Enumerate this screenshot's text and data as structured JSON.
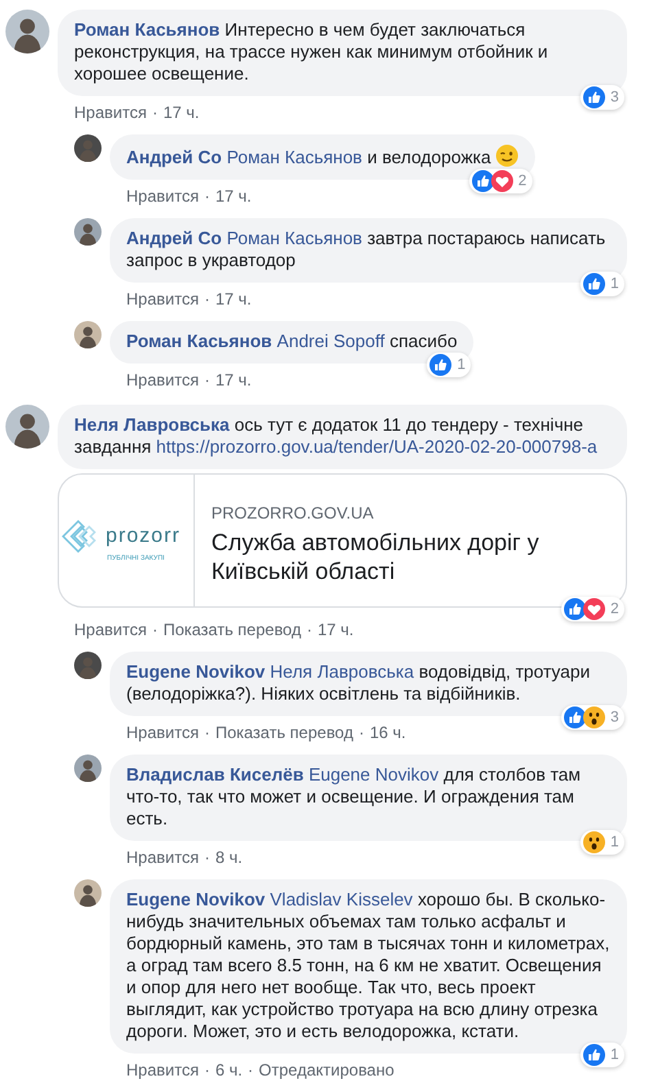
{
  "comments": [
    {
      "author": "Роман Касьянов",
      "text": "Интересно в чем будет заключаться реконструкция, на трассе нужен как минимум отбойник и хорошее освещение.",
      "reactions": {
        "icons": [
          {
            "kind": "like"
          }
        ],
        "count": "3"
      },
      "actions": [
        {
          "kind": "link",
          "text": "Нравится"
        },
        {
          "kind": "sep",
          "text": "·"
        },
        {
          "kind": "time",
          "text": "17 ч."
        }
      ],
      "replies": [
        {
          "author": "Андрей Со",
          "mention": "Роман Касьянов",
          "text": "и велодорожка",
          "emoji": true,
          "reactions": {
            "icons": [
              {
                "kind": "like"
              },
              {
                "kind": "love"
              }
            ],
            "count": "2"
          },
          "actions": [
            {
              "kind": "link",
              "text": "Нравится"
            },
            {
              "kind": "sep",
              "text": "·"
            },
            {
              "kind": "time",
              "text": "17 ч."
            }
          ]
        },
        {
          "author": "Андрей Со",
          "mention": "Роман Касьянов",
          "text": "завтра постараюсь написать запрос в укравтодор",
          "reactions": {
            "icons": [
              {
                "kind": "like"
              }
            ],
            "count": "1"
          },
          "actions": [
            {
              "kind": "link",
              "text": "Нравится"
            },
            {
              "kind": "sep",
              "text": "·"
            },
            {
              "kind": "time",
              "text": "17 ч."
            }
          ]
        },
        {
          "author": "Роман Касьянов",
          "mention": "Andrei Sopoff",
          "text": "спасибо",
          "reactions": {
            "icons": [
              {
                "kind": "like"
              }
            ],
            "count": "1"
          },
          "actions": [
            {
              "kind": "link",
              "text": "Нравится"
            },
            {
              "kind": "sep",
              "text": "·"
            },
            {
              "kind": "time",
              "text": "17 ч."
            }
          ]
        }
      ]
    },
    {
      "author": "Неля Лавровська",
      "text": "ось тут є додаток 11 до тендеру - технічне завдання",
      "link": "https://prozorro.gov.ua/tender/UA-2020-02-20-000798-a",
      "link_preview": {
        "logo_text": "prozorr",
        "logo_subtext": "ПУБЛІЧНІ ЗАКУПІ",
        "domain": "PROZORRO.GOV.UA",
        "title": "Служба автомобільних доріг у Київській області"
      },
      "reactions": {
        "icons": [
          {
            "kind": "like"
          },
          {
            "kind": "love"
          }
        ],
        "count": "2"
      },
      "actions": [
        {
          "kind": "link",
          "text": "Нравится"
        },
        {
          "kind": "sep",
          "text": "·"
        },
        {
          "kind": "link",
          "text": "Показать перевод"
        },
        {
          "kind": "sep",
          "text": "·"
        },
        {
          "kind": "time",
          "text": "17 ч."
        }
      ],
      "replies": [
        {
          "author": "Eugene Novikov",
          "mention": "Неля Лавровська",
          "text": "водовідвід, тротуари (велодоріжка?). Ніяких освітлень та відбійників.",
          "reactions": {
            "icons": [
              {
                "kind": "like"
              },
              {
                "kind": "wow"
              }
            ],
            "count": "3"
          },
          "actions": [
            {
              "kind": "link",
              "text": "Нравится"
            },
            {
              "kind": "sep",
              "text": "·"
            },
            {
              "kind": "link",
              "text": "Показать перевод"
            },
            {
              "kind": "sep",
              "text": "·"
            },
            {
              "kind": "time",
              "text": "16 ч."
            }
          ]
        },
        {
          "author": "Владислав Киселёв",
          "mention": "Eugene Novikov",
          "text": "для столбов там что-то, так что может и освещение. И ограждения там есть.",
          "reactions": {
            "icons": [
              {
                "kind": "wow"
              }
            ],
            "count": "1"
          },
          "actions": [
            {
              "kind": "link",
              "text": "Нравится"
            },
            {
              "kind": "sep",
              "text": "·"
            },
            {
              "kind": "time",
              "text": "8 ч."
            }
          ]
        },
        {
          "author": "Eugene Novikov",
          "mention": "Vladislav Kisselev",
          "text": "хорошо бы. В сколько-нибудь значительных объемах там только асфальт и бордюрный камень, это там в тысячах тонн и километрах, а оград там всего 8.5 тонн, на 6 км не хватит. Освещения и опор для него нет вообще. Так что, весь проект выглядит, как устройство тротуара на всю длину отрезка дороги. Может, это и есть велодорожка, кстати.",
          "reactions": {
            "icons": [
              {
                "kind": "like"
              }
            ],
            "count": "1"
          },
          "actions": [
            {
              "kind": "link",
              "text": "Нравится"
            },
            {
              "kind": "sep",
              "text": "·"
            },
            {
              "kind": "time",
              "text": "6 ч."
            },
            {
              "kind": "sep",
              "text": "·"
            },
            {
              "kind": "link",
              "text": "Отредактировано"
            }
          ]
        }
      ]
    }
  ]
}
